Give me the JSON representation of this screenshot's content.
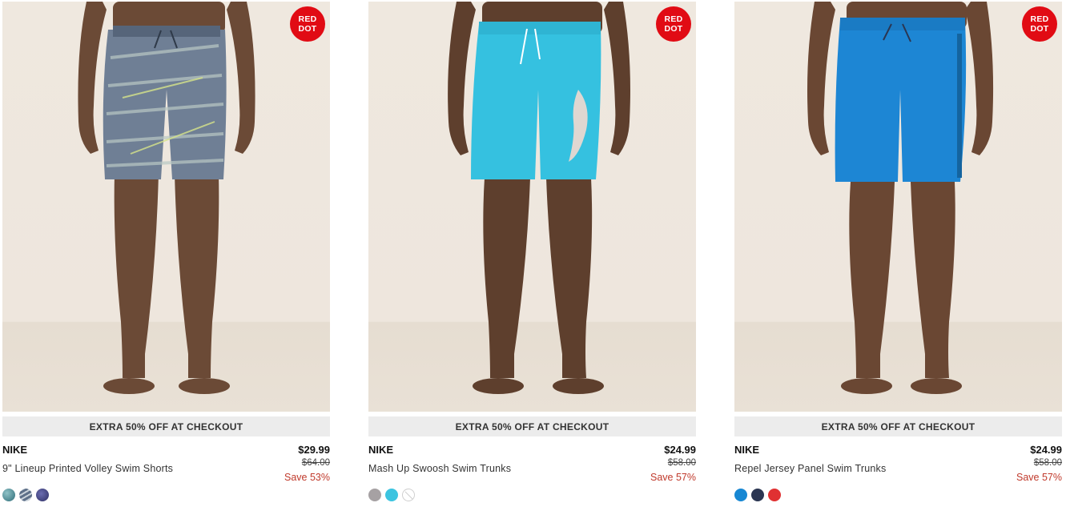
{
  "products": [
    {
      "badge": "RED\nDOT",
      "promo": "EXTRA 50% OFF AT CHECKOUT",
      "brand": "NIKE",
      "name": "9\" Lineup Printed Volley Swim Shorts",
      "price": "$29.99",
      "original_price": "$64.00",
      "save": "Save 53%",
      "shorts_color": "#6f7f95",
      "swatches": [
        {
          "name": "teal-print-swatch",
          "color": "#3f7f8a"
        },
        {
          "name": "grey-print-swatch",
          "color": "#7d8fa3"
        },
        {
          "name": "navy-print-swatch",
          "color": "#3a3d73"
        }
      ]
    },
    {
      "badge": "RED\nDOT",
      "promo": "EXTRA 50% OFF AT CHECKOUT",
      "brand": "NIKE",
      "name": "Mash Up Swoosh Swim Trunks",
      "price": "$24.99",
      "original_price": "$58.00",
      "save": "Save 57%",
      "shorts_color": "#35c1e0",
      "swatches": [
        {
          "name": "grey-swatch",
          "color": "#a6a1a3"
        },
        {
          "name": "aqua-swatch",
          "color": "#3cc4e0"
        },
        {
          "name": "unavailable-swatch",
          "color": "none"
        }
      ]
    },
    {
      "badge": "RED\nDOT",
      "promo": "EXTRA 50% OFF AT CHECKOUT",
      "brand": "NIKE",
      "name": "Repel Jersey Panel Swim Trunks",
      "price": "$24.99",
      "original_price": "$58.00",
      "save": "Save 57%",
      "shorts_color": "#1d86d4",
      "swatches": [
        {
          "name": "blue-swatch",
          "color": "#1787d3"
        },
        {
          "name": "navy-swatch",
          "color": "#2b3652"
        },
        {
          "name": "red-swatch",
          "color": "#e03132"
        }
      ]
    }
  ]
}
